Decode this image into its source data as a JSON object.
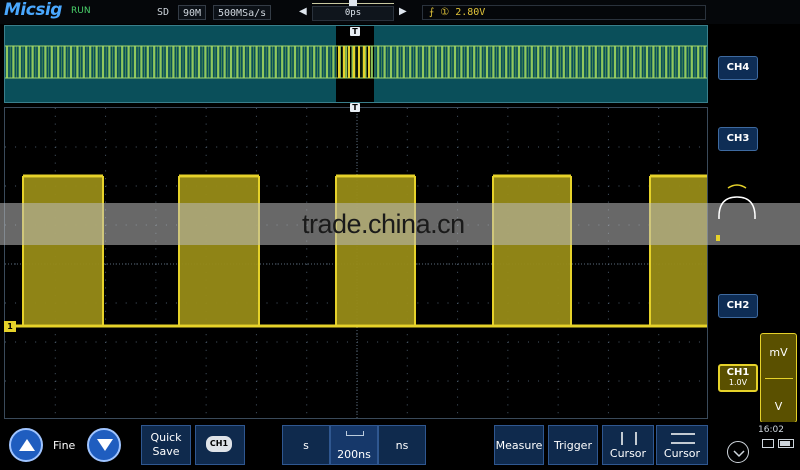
{
  "header": {
    "brand": "Micsig",
    "run_state": "RUN",
    "mode": "SD",
    "memory": "90M",
    "sample_rate": "500MSa/s",
    "time_offset": "0ps",
    "trigger_info": "⨍ ① 2.80V",
    "trigger_level": "2.80V"
  },
  "channels": {
    "ch4": "CH4",
    "ch3": "CH3",
    "ch2": "CH2",
    "ch1": "CH1",
    "ch1_scale": "1.0V",
    "ch1_marker": "1"
  },
  "volt_panel": {
    "up": "mV",
    "down": "V"
  },
  "watermark": "trade.china.cn",
  "bottom": {
    "fine_label": "Fine",
    "quick_save": "Quick Save",
    "ch_mini": "CH1",
    "timebase_left": "s",
    "timebase_value": "200ns",
    "timebase_right": "ns",
    "measure": "Measure",
    "trigger": "Trigger",
    "cursor1": "Cursor",
    "cursor2": "Cursor",
    "clock": "16:02"
  },
  "colors": {
    "ch1_yellow": "#e6d22a",
    "overview_bg": "#0a4f5a",
    "button_blue": "#0e2d55"
  },
  "icons": {
    "up_arrow": "up-arrow-icon",
    "down_arrow": "down-arrow-icon",
    "battery": "battery-icon"
  }
}
